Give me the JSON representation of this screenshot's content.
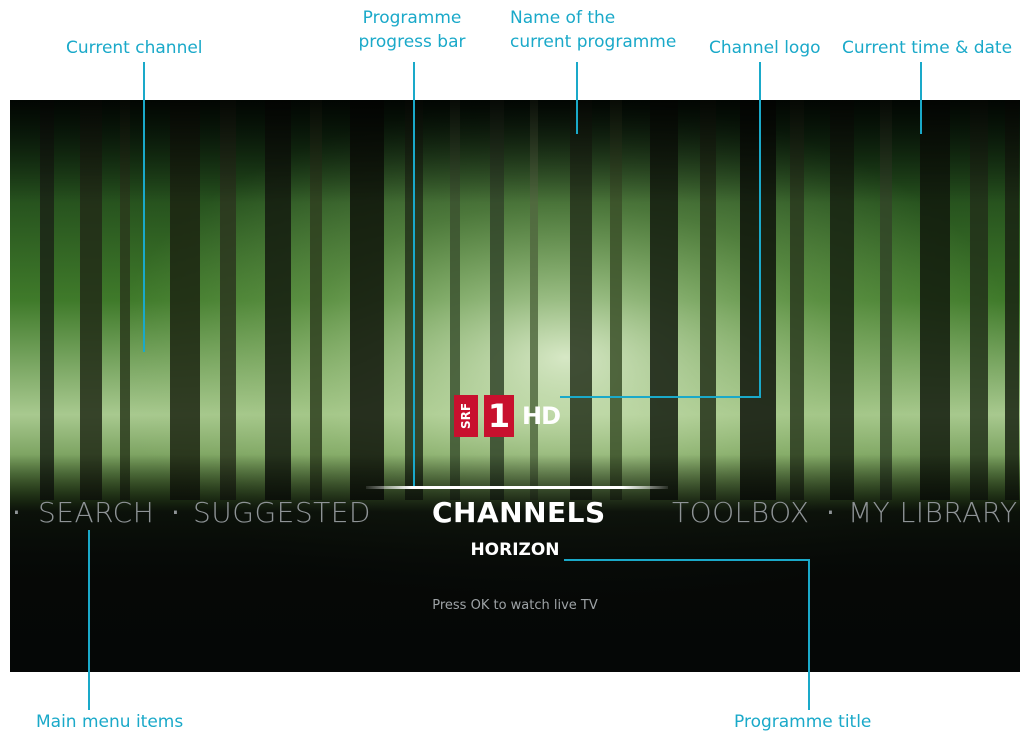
{
  "callouts": {
    "current_channel": "Current channel",
    "progress_bar_line1": "Programme",
    "progress_bar_line2": "progress bar",
    "programme_name_line1": "Name of the",
    "programme_name_line2": "current programme",
    "channel_logo": "Channel logo",
    "time_date": "Current time & date",
    "main_menu_items": "Main menu items",
    "programme_title": "Programme title"
  },
  "screen": {
    "logo": {
      "srf": "SRF",
      "one": "1",
      "hd": "HD"
    },
    "menu": {
      "items": [
        {
          "label": "SEARCH",
          "active": false
        },
        {
          "label": "SUGGESTED",
          "active": false
        },
        {
          "label": "CHANNELS",
          "active": true
        },
        {
          "label": "TOOLBOX",
          "active": false
        },
        {
          "label": "MY LIBRARY",
          "active": false
        }
      ],
      "separator": "·"
    },
    "programme_title": "HORIZON",
    "hint": "Press OK to watch live TV"
  },
  "colors": {
    "callout": "#1aa9c9",
    "logo_red": "#c8102e",
    "menu_inactive": "#8e9396",
    "menu_active": "#ffffff"
  }
}
